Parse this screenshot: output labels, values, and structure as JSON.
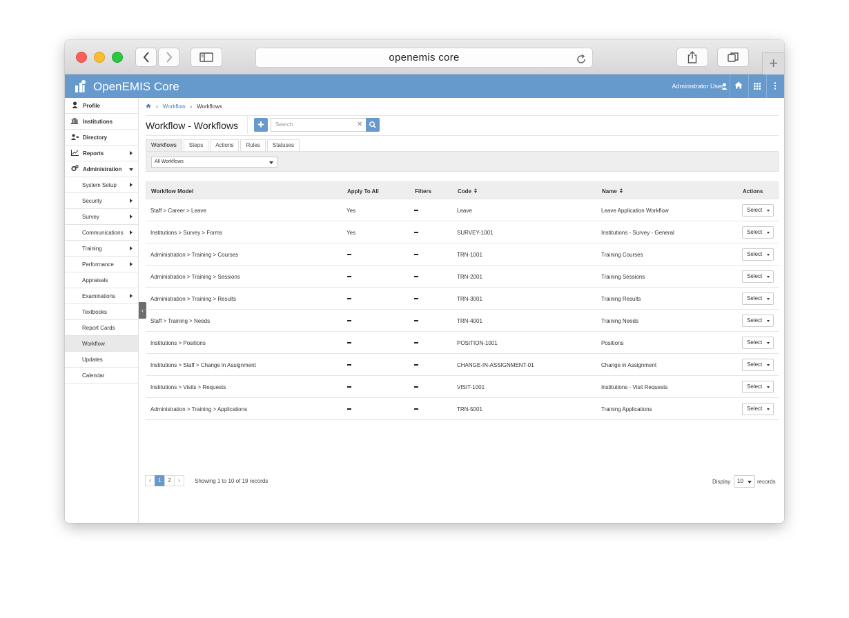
{
  "browser": {
    "url": "openemis core"
  },
  "app": {
    "name": "OpenEMIS Core",
    "user": "Administrator User",
    "accent_color": "#6699cc"
  },
  "sidebar": {
    "items": [
      {
        "label": "Profile",
        "icon": "user-icon",
        "level": "top"
      },
      {
        "label": "Institutions",
        "icon": "institution-icon",
        "level": "top"
      },
      {
        "label": "Directory",
        "icon": "users-icon",
        "level": "top"
      },
      {
        "label": "Reports",
        "icon": "chart-icon",
        "level": "top",
        "arrow": "right"
      },
      {
        "label": "Administration",
        "icon": "cogs-icon",
        "level": "top",
        "arrow": "down"
      },
      {
        "label": "System Setup",
        "level": "sub",
        "arrow": "right"
      },
      {
        "label": "Security",
        "level": "sub",
        "arrow": "right"
      },
      {
        "label": "Survey",
        "level": "sub",
        "arrow": "right"
      },
      {
        "label": "Communications",
        "level": "sub",
        "arrow": "right"
      },
      {
        "label": "Training",
        "level": "sub",
        "arrow": "right"
      },
      {
        "label": "Performance",
        "level": "sub",
        "arrow": "right"
      },
      {
        "label": "Appraisals",
        "level": "sub"
      },
      {
        "label": "Examinations",
        "level": "sub",
        "arrow": "right"
      },
      {
        "label": "Textbooks",
        "level": "sub"
      },
      {
        "label": "Report Cards",
        "level": "sub"
      },
      {
        "label": "Workflow",
        "level": "sub",
        "active": true
      },
      {
        "label": "Updates",
        "level": "sub"
      },
      {
        "label": "Calendar",
        "level": "sub"
      }
    ]
  },
  "breadcrumb": {
    "items": [
      "Workflow",
      "Workflows"
    ]
  },
  "page": {
    "title": "Workflow - Workflows",
    "search_placeholder": "Search"
  },
  "tabs": [
    "Workflows",
    "Steps",
    "Actions",
    "Rules",
    "Statuses"
  ],
  "filter": {
    "selected": "All Workflows"
  },
  "table": {
    "columns": [
      "Workflow Model",
      "Apply To All",
      "Filters",
      "Code",
      "Name",
      "Actions"
    ],
    "action_label": "Select",
    "rows": [
      {
        "model": "Staff > Career > Leave",
        "apply": "Yes",
        "code": "Leave",
        "name": "Leave Application Workflow"
      },
      {
        "model": "Institutions > Survey > Forms",
        "apply": "Yes",
        "code": "SURVEY-1001",
        "name": "Institutions - Survey - General"
      },
      {
        "model": "Administration > Training > Courses",
        "apply": "",
        "code": "TRN-1001",
        "name": "Training Courses"
      },
      {
        "model": "Administration > Training > Sessions",
        "apply": "",
        "code": "TRN-2001",
        "name": "Training Sessions"
      },
      {
        "model": "Administration > Training > Results",
        "apply": "",
        "code": "TRN-3001",
        "name": "Training Results"
      },
      {
        "model": "Staff > Training > Needs",
        "apply": "",
        "code": "TRN-4001",
        "name": "Training Needs"
      },
      {
        "model": "Institutions > Positions",
        "apply": "",
        "code": "POSITION-1001",
        "name": "Positions"
      },
      {
        "model": "Institutions > Staff > Change in Assignment",
        "apply": "",
        "code": "CHANGE-IN-ASSIGNMENT-01",
        "name": "Change in Assignment"
      },
      {
        "model": "Institutions > Visits > Requests",
        "apply": "",
        "code": "VISIT-1001",
        "name": "Institutions - Visit Requests"
      },
      {
        "model": "Administration > Training > Applications",
        "apply": "",
        "code": "TRN-5001",
        "name": "Training Applications"
      }
    ]
  },
  "pagination": {
    "prev": "‹",
    "pages": [
      "1",
      "2"
    ],
    "next": "›",
    "current": "1",
    "summary": "Showing 1 to 10 of 19 records",
    "display_label": "Display",
    "page_size": "10",
    "records_label": "records"
  }
}
